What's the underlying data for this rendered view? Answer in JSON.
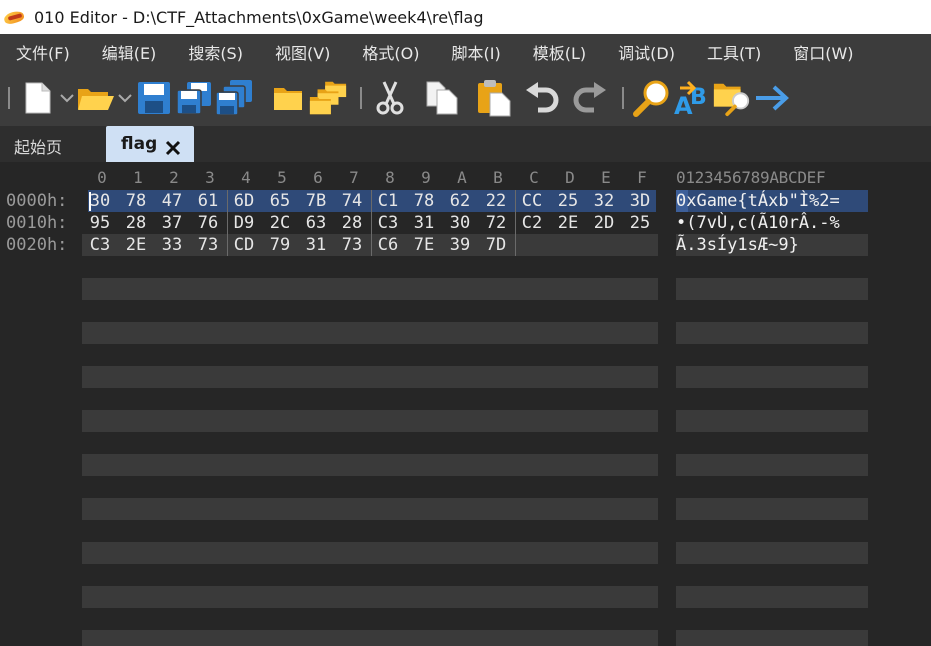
{
  "window": {
    "title": "010 Editor - D:\\CTF_Attachments\\0xGame\\week4\\re\\flag"
  },
  "menu": [
    "文件(F)",
    "编辑(E)",
    "搜索(S)",
    "视图(V)",
    "格式(O)",
    "脚本(I)",
    "模板(L)",
    "调试(D)",
    "工具(T)",
    "窗口(W)"
  ],
  "tabs": {
    "start": "起始页",
    "active": "flag"
  },
  "hex": {
    "column_headers": [
      "0",
      "1",
      "2",
      "3",
      "4",
      "5",
      "6",
      "7",
      "8",
      "9",
      "A",
      "B",
      "C",
      "D",
      "E",
      "F"
    ],
    "ascii_header": "0123456789ABCDEF",
    "rows": [
      {
        "address": "0000h:",
        "bytes": [
          "30",
          "78",
          "47",
          "61",
          "6D",
          "65",
          "7B",
          "74",
          "C1",
          "78",
          "62",
          "22",
          "CC",
          "25",
          "32",
          "3D"
        ],
        "ascii": "0xGame{tÁxb\"Ì%2="
      },
      {
        "address": "0010h:",
        "bytes": [
          "95",
          "28",
          "37",
          "76",
          "D9",
          "2C",
          "63",
          "28",
          "C3",
          "31",
          "30",
          "72",
          "C2",
          "2E",
          "2D",
          "25"
        ],
        "ascii": "•(7vÙ,c(Ã10rÂ.-%"
      },
      {
        "address": "0020h:",
        "bytes": [
          "C3",
          "2E",
          "33",
          "73",
          "CD",
          "79",
          "31",
          "73",
          "C6",
          "7E",
          "39",
          "7D"
        ],
        "ascii": "Ã.3sÍy1sÆ~9}"
      }
    ]
  },
  "colors": {
    "selection": "#2f4a78",
    "tab_active": "#cfe0f4",
    "toolbar_bg": "#3c3c3c",
    "editor_bg": "#262626"
  }
}
